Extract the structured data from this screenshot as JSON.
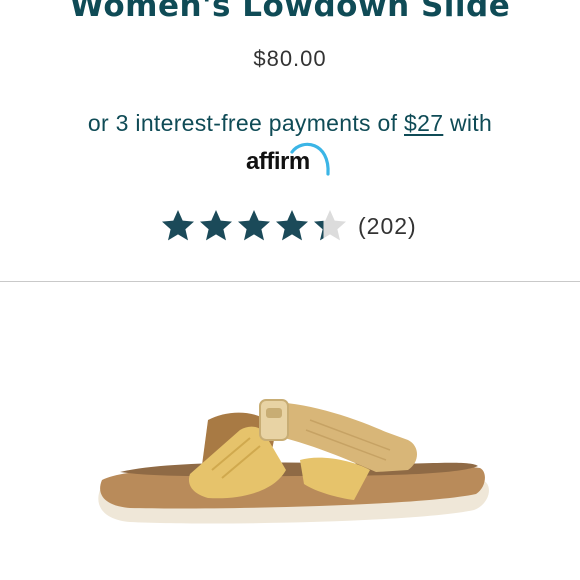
{
  "product": {
    "title": "Women's Lowdown Slide",
    "price": "$80.00",
    "image_alt": "sandal-product-image"
  },
  "financing": {
    "prefix": "or 3 interest-free payments of ",
    "installment_amount": "$27",
    "suffix": " with",
    "provider_logo_text": "affirm"
  },
  "rating": {
    "value": 4.3,
    "max": 5,
    "review_count": "(202)",
    "filled_color": "#1b4a59",
    "empty_color": "#dcdcdc"
  },
  "colors": {
    "brand_teal": "#0f4b56",
    "affirm_blue": "#3bb5e6",
    "divider": "#c9c9c9"
  }
}
